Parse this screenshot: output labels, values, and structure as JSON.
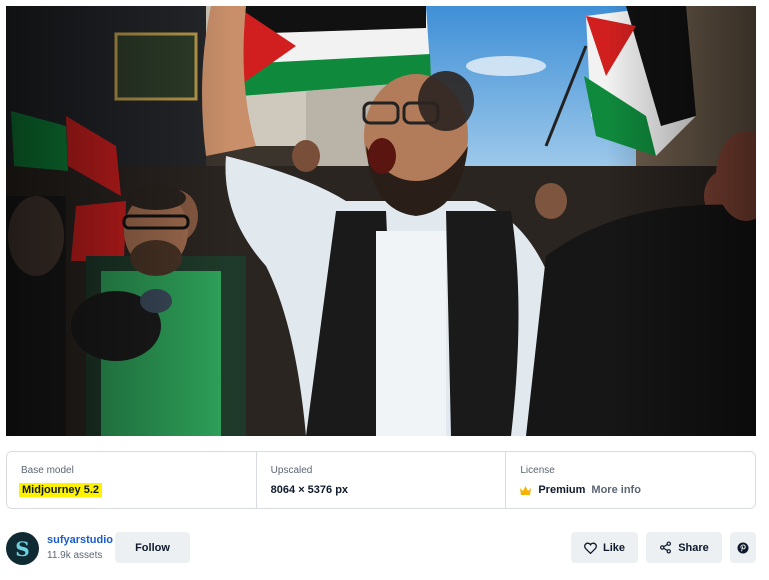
{
  "image": {
    "alt": "",
    "colors": {
      "flag_red": "#d11f1f",
      "flag_green": "#0f8a3c",
      "flag_black": "#111111",
      "sky": "#4f9fdc"
    }
  },
  "details": {
    "base_model": {
      "label": "Base model",
      "value": "Midjourney 5.2",
      "highlight_color": "#fff200"
    },
    "upscaled": {
      "label": "Upscaled",
      "value": "8064 × 5376 px"
    },
    "license": {
      "label": "License",
      "value": "Premium",
      "more_info": "More info",
      "icon": "crown-icon",
      "icon_color": "#f5b400"
    }
  },
  "author": {
    "avatar_letter": "S",
    "name": "sufyarstudio",
    "assets": "11.9k assets",
    "follow_label": "Follow"
  },
  "actions": {
    "like_label": "Like",
    "share_label": "Share",
    "pin_icon": "pinterest-icon"
  }
}
